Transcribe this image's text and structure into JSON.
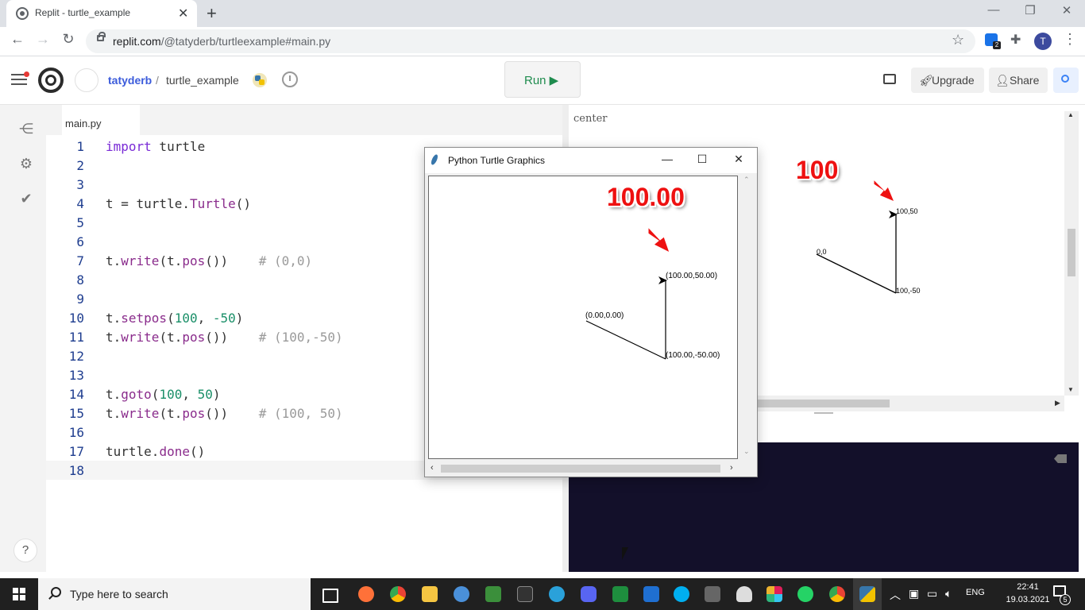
{
  "browser": {
    "tab_title": "Replit - turtle_example",
    "url_host": "replit.com",
    "url_path": "/@tatyderb/turtleexample#main.py",
    "profile_initial": "T",
    "extension_badge": "2"
  },
  "header": {
    "owner": "tatyderb",
    "separator": "/",
    "repl_name": "turtle_example",
    "run_label": "Run ▶",
    "upgrade_label": "Upgrade",
    "share_label": "Share"
  },
  "editor": {
    "file_tab": "main.py",
    "line_numbers": [
      "1",
      "2",
      "3",
      "4",
      "5",
      "6",
      "7",
      "8",
      "9",
      "10",
      "11",
      "12",
      "13",
      "14",
      "15",
      "16",
      "17",
      "18"
    ]
  },
  "output": {
    "center_label": "center",
    "annotation_100": "100",
    "labels": {
      "origin": "0,0",
      "p1": "100,-50",
      "p2": "100,50"
    }
  },
  "turtle_window": {
    "title": "Python Turtle Graphics",
    "annotation": "100.00",
    "labels": {
      "origin": "(0.00,0.00)",
      "p1": "(100.00,-50.00)",
      "p2": "(100.00,50.00)"
    }
  },
  "help_label": "?",
  "taskbar": {
    "search_placeholder": "Type here to search",
    "lang": "ENG",
    "time": "22:41",
    "date": "19.03.2021",
    "notifications": "5"
  }
}
